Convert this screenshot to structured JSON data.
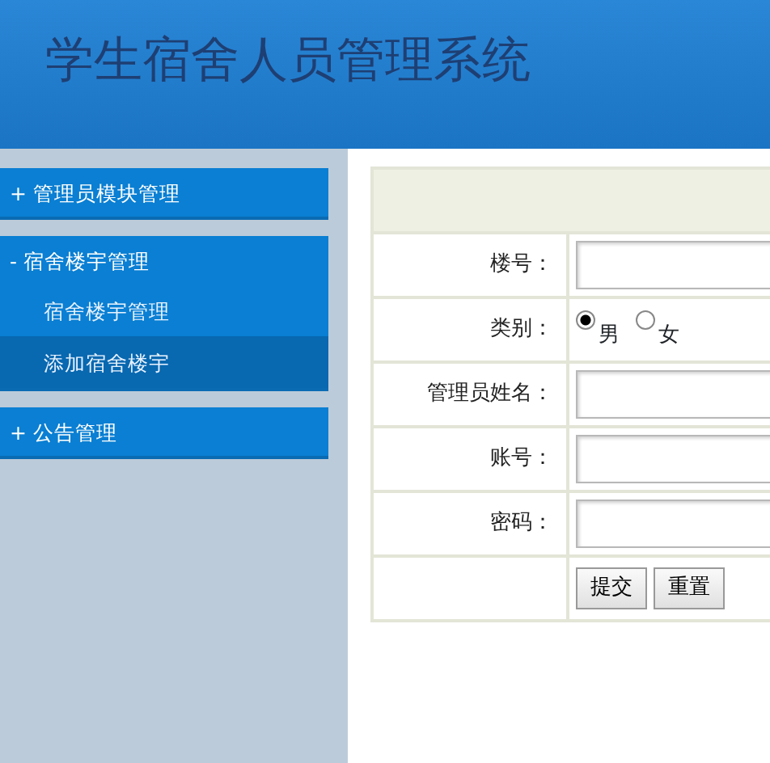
{
  "header": {
    "title": "学生宿舍人员管理系统"
  },
  "sidebar": {
    "groups": [
      {
        "label": "管理员模块管理",
        "toggle": "+"
      },
      {
        "label": "宿舍楼宇管理",
        "toggle": "-",
        "items": [
          {
            "label": "宿舍楼宇管理",
            "selected": false
          },
          {
            "label": "添加宿舍楼宇",
            "selected": true
          }
        ]
      },
      {
        "label": "公告管理",
        "toggle": "+"
      }
    ]
  },
  "form": {
    "fields": [
      {
        "kind": "text",
        "label": "楼号："
      },
      {
        "kind": "radio",
        "label": "类别：",
        "options": [
          {
            "label": "男",
            "selected": true
          },
          {
            "label": "女",
            "selected": false
          }
        ]
      },
      {
        "kind": "text",
        "label": "管理员姓名："
      },
      {
        "kind": "text",
        "label": "账号："
      },
      {
        "kind": "text",
        "label": "密码："
      }
    ],
    "buttons": [
      "提交",
      "重置"
    ]
  }
}
